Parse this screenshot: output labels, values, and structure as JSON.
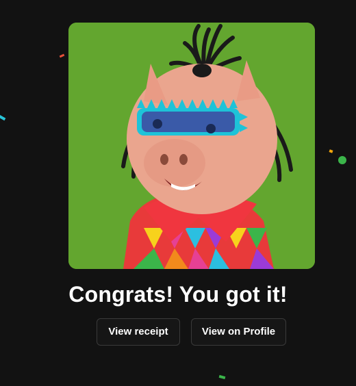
{
  "dialog": {
    "title": "Congrats! You got it!",
    "buttons": {
      "view_receipt": "View receipt",
      "view_on_profile": "View on Profile"
    }
  },
  "nft": {
    "background_color": "#63a62f",
    "subject": "pig-character-with-sunglasses-and-dreadlocks"
  },
  "colors": {
    "page_background": "#121212",
    "button_border": "#3a3a3a",
    "text": "#ffffff"
  }
}
